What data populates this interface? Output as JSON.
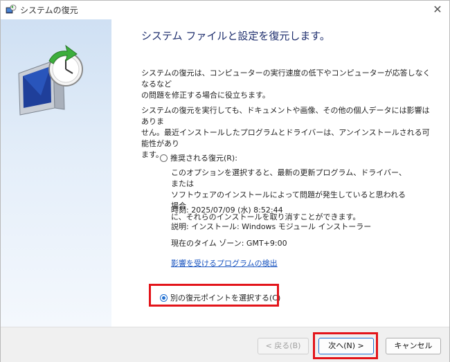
{
  "window": {
    "title": "システムの復元"
  },
  "main": {
    "heading": "システム ファイルと設定を復元します。",
    "para1_lines": [
      "システムの復元は、コンピューターの実行速度の低下やコンピューターが応答しなくなるなど",
      "の問題を修正する場合に役立ちます。"
    ],
    "para2_lines": [
      "システムの復元を実行しても、ドキュメントや画像、その他の個人データには影響はありま",
      "せん。最近インストールしたプログラムとドライバーは、アンインストールされる可能性があり",
      "ます。"
    ]
  },
  "options": {
    "recommended": {
      "label": "推奨される復元(R):",
      "checked": false,
      "description_lines": [
        "このオプションを選択すると、最新の更新プログラム、ドライバー、または",
        "ソフトウェアのインストールによって問題が発生していると思われる場合",
        "に、それらのインストールを取り消すことができます。"
      ],
      "time": "時刻: 2025/07/09 (水) 8:52:44",
      "description": "説明: インストール: Windows モジュール インストーラー",
      "timezone": "現在のタイム ゾーン: GMT+9:00",
      "scan_link": "影響を受けるプログラムの検出"
    },
    "choose_other": {
      "label": "別の復元ポイントを選択する(C)",
      "checked": true
    }
  },
  "footer": {
    "back": "< 戻る(B)",
    "next": "次へ(N) >",
    "cancel": "キャンセル"
  },
  "colors": {
    "highlight": "#e3141a",
    "accent": "#1f6fd1",
    "heading": "#1f2f6e",
    "link": "#1a55c0"
  },
  "icons": {
    "app": "system-restore-icon",
    "side": "restore-monitor-clock-icon",
    "close": "close-icon"
  }
}
